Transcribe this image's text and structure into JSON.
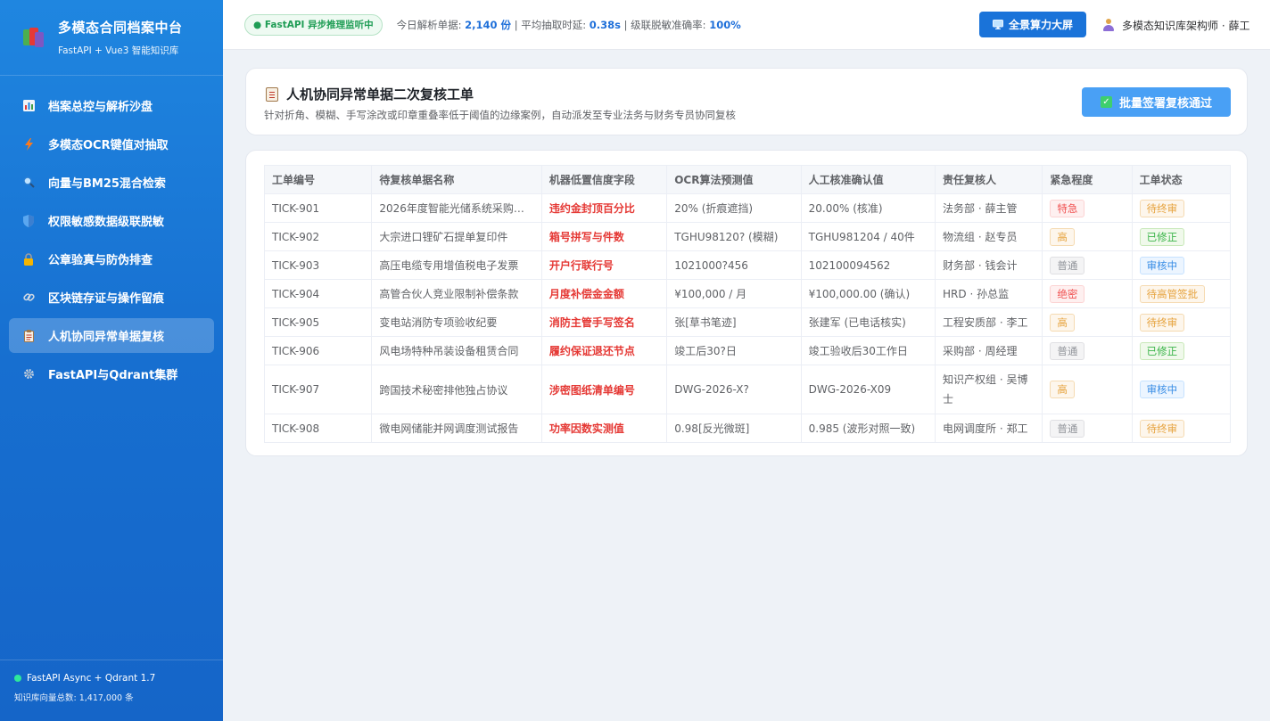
{
  "sidebar": {
    "brand_title": "多模态合同档案中台",
    "brand_subtitle": "FastAPI + Vue3 智能知识库",
    "items": [
      {
        "label": "档案总控与解析沙盘",
        "icon": "bar-chart-icon"
      },
      {
        "label": "多模态OCR键值对抽取",
        "icon": "lightning-icon"
      },
      {
        "label": "向量与BM25混合检索",
        "icon": "magnifier-icon"
      },
      {
        "label": "权限敏感数据级联脱敏",
        "icon": "shield-icon"
      },
      {
        "label": "公章验真与防伪排查",
        "icon": "lock-icon"
      },
      {
        "label": "区块链存证与操作留痕",
        "icon": "link-icon"
      },
      {
        "label": "人机协同异常单据复核",
        "icon": "clipboard-icon",
        "active": true
      },
      {
        "label": "FastAPI与Qdrant集群",
        "icon": "gear-icon"
      }
    ],
    "footer_status": "FastAPI Async + Qdrant 1.7",
    "footer_vectors": "知识库向量总数: 1,417,000 条"
  },
  "topbar": {
    "status_pill": "● FastAPI 异步推理监听中",
    "metric1_label": "今日解析单据:",
    "metric1_value": "2,140 份",
    "metric2_label": "| 平均抽取时延:",
    "metric2_value": "0.38s",
    "metric3_label": "| 级联脱敏准确率:",
    "metric3_value": "100%",
    "screen_button": "全景算力大屏",
    "user_name": "多模态知识库架构师 · 薛工"
  },
  "header": {
    "title": "人机协同异常单据二次复核工单",
    "subtitle": "针对折角、模糊、手写涂改或印章重叠率低于阈值的边缘案例，自动派发至专业法务与财务专员协同复核",
    "batch_button": "批量签署复核通过"
  },
  "table": {
    "columns": [
      "工单编号",
      "待复核单据名称",
      "机器低置信度字段",
      "OCR算法预测值",
      "人工核准确认值",
      "责任复核人",
      "紧急程度",
      "工单状态"
    ],
    "rows": [
      {
        "id": "TICK-901",
        "name": "2026年度智能光储系统采购补...",
        "field": "违约金封顶百分比",
        "ocr": "20% (折痕遮挡)",
        "confirm": "20.00% (核准)",
        "owner": "法务部 · 薛主管",
        "urgency": "特急",
        "urgency_color": "red",
        "status": "待终审",
        "status_color": "orange"
      },
      {
        "id": "TICK-902",
        "name": "大宗进口锂矿石提单复印件",
        "field": "箱号拼写与件数",
        "ocr": "TGHU98120? (模糊)",
        "confirm": "TGHU981204 / 40件",
        "owner": "物流组 · 赵专员",
        "urgency": "高",
        "urgency_color": "orange",
        "status": "已修正",
        "status_color": "green"
      },
      {
        "id": "TICK-903",
        "name": "高压电缆专用增值税电子发票",
        "field": "开户行联行号",
        "ocr": "1021000?456",
        "confirm": "102100094562",
        "owner": "财务部 · 钱会计",
        "urgency": "普通",
        "urgency_color": "gray",
        "status": "审核中",
        "status_color": "blue"
      },
      {
        "id": "TICK-904",
        "name": "高管合伙人竞业限制补偿条款",
        "field": "月度补偿金金额",
        "ocr": "¥100,000 / 月",
        "confirm": "¥100,000.00 (确认)",
        "owner": "HRD · 孙总监",
        "urgency": "绝密",
        "urgency_color": "red",
        "status": "待高管签批",
        "status_color": "orange"
      },
      {
        "id": "TICK-905",
        "name": "变电站消防专项验收纪要",
        "field": "消防主管手写签名",
        "ocr": "张[草书笔迹]",
        "confirm": "张建军 (已电话核实)",
        "owner": "工程安质部 · 李工",
        "urgency": "高",
        "urgency_color": "orange",
        "status": "待终审",
        "status_color": "orange"
      },
      {
        "id": "TICK-906",
        "name": "风电场特种吊装设备租赁合同",
        "field": "履约保证退还节点",
        "ocr": "竣工后30?日",
        "confirm": "竣工验收后30工作日",
        "owner": "采购部 · 周经理",
        "urgency": "普通",
        "urgency_color": "gray",
        "status": "已修正",
        "status_color": "green"
      },
      {
        "id": "TICK-907",
        "name": "跨国技术秘密排他独占协议",
        "field": "涉密图纸清单编号",
        "ocr": "DWG-2026-X?",
        "confirm": "DWG-2026-X09",
        "owner": "知识产权组 · 吴博士",
        "urgency": "高",
        "urgency_color": "orange",
        "status": "审核中",
        "status_color": "blue",
        "tall": true
      },
      {
        "id": "TICK-908",
        "name": "微电网储能并网调度测试报告",
        "field": "功率因数实测值",
        "ocr": "0.98[反光微斑]",
        "confirm": "0.985 (波形对照一致)",
        "owner": "电网调度所 · 郑工",
        "urgency": "普通",
        "urgency_color": "gray",
        "status": "待终审",
        "status_color": "orange"
      }
    ]
  }
}
